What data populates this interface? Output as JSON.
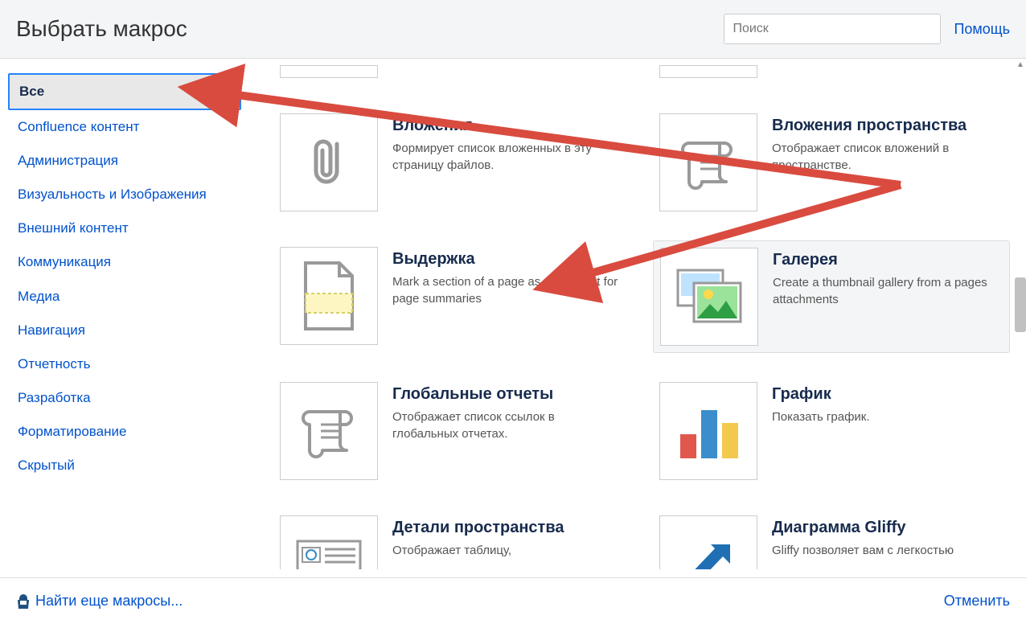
{
  "header": {
    "title": "Выбрать макрос",
    "search_placeholder": "Поиск",
    "help": "Помощь"
  },
  "sidebar": {
    "items": [
      {
        "label": "Все",
        "selected": true
      },
      {
        "label": "Confluence контент"
      },
      {
        "label": "Администрация"
      },
      {
        "label": "Визуальность и Изображения"
      },
      {
        "label": "Внешний контент"
      },
      {
        "label": "Коммуникация"
      },
      {
        "label": "Медиа"
      },
      {
        "label": "Навигация"
      },
      {
        "label": "Отчетность"
      },
      {
        "label": "Разработка"
      },
      {
        "label": "Форматирование"
      },
      {
        "label": "Скрытый"
      }
    ]
  },
  "macros": {
    "r1c1": {
      "title": "Вложения",
      "desc": "Формирует список вложенных в эту страницу файлов."
    },
    "r1c2": {
      "title": "Вложения пространства",
      "desc": "Отображает список вложений в пространстве."
    },
    "r2c1": {
      "title": "Выдержка",
      "desc": "Mark a section of a page as an excerpt for page summaries"
    },
    "r2c2": {
      "title": "Галерея",
      "desc": "Create a thumbnail gallery from a pages attachments"
    },
    "r3c1": {
      "title": "Глобальные отчеты",
      "desc": "Отображает список ссылок в глобальных отчетах."
    },
    "r3c2": {
      "title": "График",
      "desc": "Показать график."
    },
    "r4c1": {
      "title": "Детали пространства",
      "desc": "Отображает таблицу,"
    },
    "r4c2": {
      "title": "Диаграмма Gliffy",
      "desc": "Gliffy позволяет вам с легкостью"
    }
  },
  "footer": {
    "find_more": "Найти еще макросы...",
    "cancel": "Отменить"
  }
}
